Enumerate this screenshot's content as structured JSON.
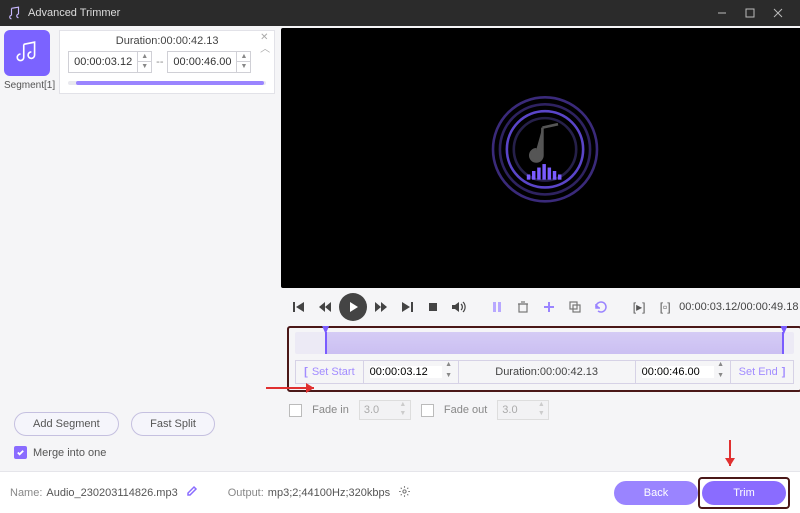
{
  "window": {
    "title": "Advanced Trimmer"
  },
  "sidebar": {
    "segment_label": "Segment[1]",
    "duration_label": "Duration:00:00:42.13",
    "start": "00:00:03.12",
    "end": "00:00:46.00",
    "dash": "--",
    "add_segment": "Add Segment",
    "fast_split": "Fast Split",
    "merge_label": "Merge into one"
  },
  "transport": {
    "time": "00:00:03.12/00:00:49.18"
  },
  "trim": {
    "set_start": "Set Start",
    "set_end": "Set End",
    "start": "00:00:03.12",
    "end": "00:00:46.00",
    "duration": "Duration:00:00:42.13"
  },
  "fade": {
    "in_label": "Fade in",
    "in_value": "3.0",
    "out_label": "Fade out",
    "out_value": "3.0"
  },
  "footer": {
    "name_label": "Name:",
    "name_value": "Audio_230203114826.mp3",
    "output_label": "Output:",
    "output_value": "mp3;2;44100Hz;320kbps",
    "back": "Back",
    "trim": "Trim"
  }
}
